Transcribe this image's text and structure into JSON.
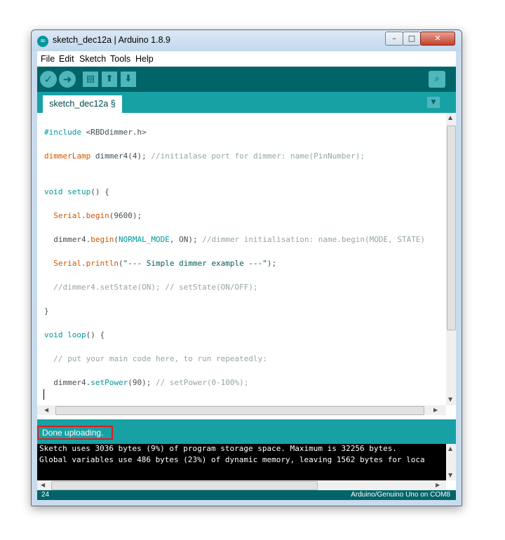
{
  "window": {
    "title": "sketch_dec12a | Arduino 1.8.9"
  },
  "menu": [
    "File",
    "Edit",
    "Sketch",
    "Tools",
    "Help"
  ],
  "toolbar": {
    "verify_icon": "check-icon",
    "upload_icon": "arrow-right-icon",
    "new_icon": "document-icon",
    "open_icon": "arrow-up-icon",
    "save_icon": "arrow-down-icon",
    "monitor_icon": "magnifier-icon"
  },
  "tab": {
    "label": "sketch_dec12a §"
  },
  "code": [
    "#include <RBDdimmer.h>",
    "dimmerLamp dimmer4(4); //initialase port for dimmer: name(PinNumber);",
    "void setup() {",
    "  Serial.begin(9600);",
    "  dimmer4.begin(NORMAL_MODE, ON); //dimmer initialisation: name.begin(MODE, STATE)",
    "  Serial.println(\"--- Simple dimmer example ---\");",
    "  //dimmer4.setState(ON); // setState(ON/OFF);",
    "}",
    "void loop() {",
    "  // put your main code here, to run repeatedly:",
    "  dimmer4.setPower(90); // setPower(0-100%);"
  ],
  "status": {
    "message": "Done uploading."
  },
  "console": [
    "Sketch uses 3036 bytes (9%) of program storage space. Maximum is 32256 bytes.",
    "Global variables use 486 bytes (23%) of dynamic memory, leaving 1562 bytes for loca"
  ],
  "footer": {
    "line_number": "24",
    "board": "Arduino/Genuino Uno on COM8"
  },
  "colors": {
    "toolbar": "#006468",
    "tabbar": "#17a1a5",
    "highlight_border": "#e11a1a"
  }
}
